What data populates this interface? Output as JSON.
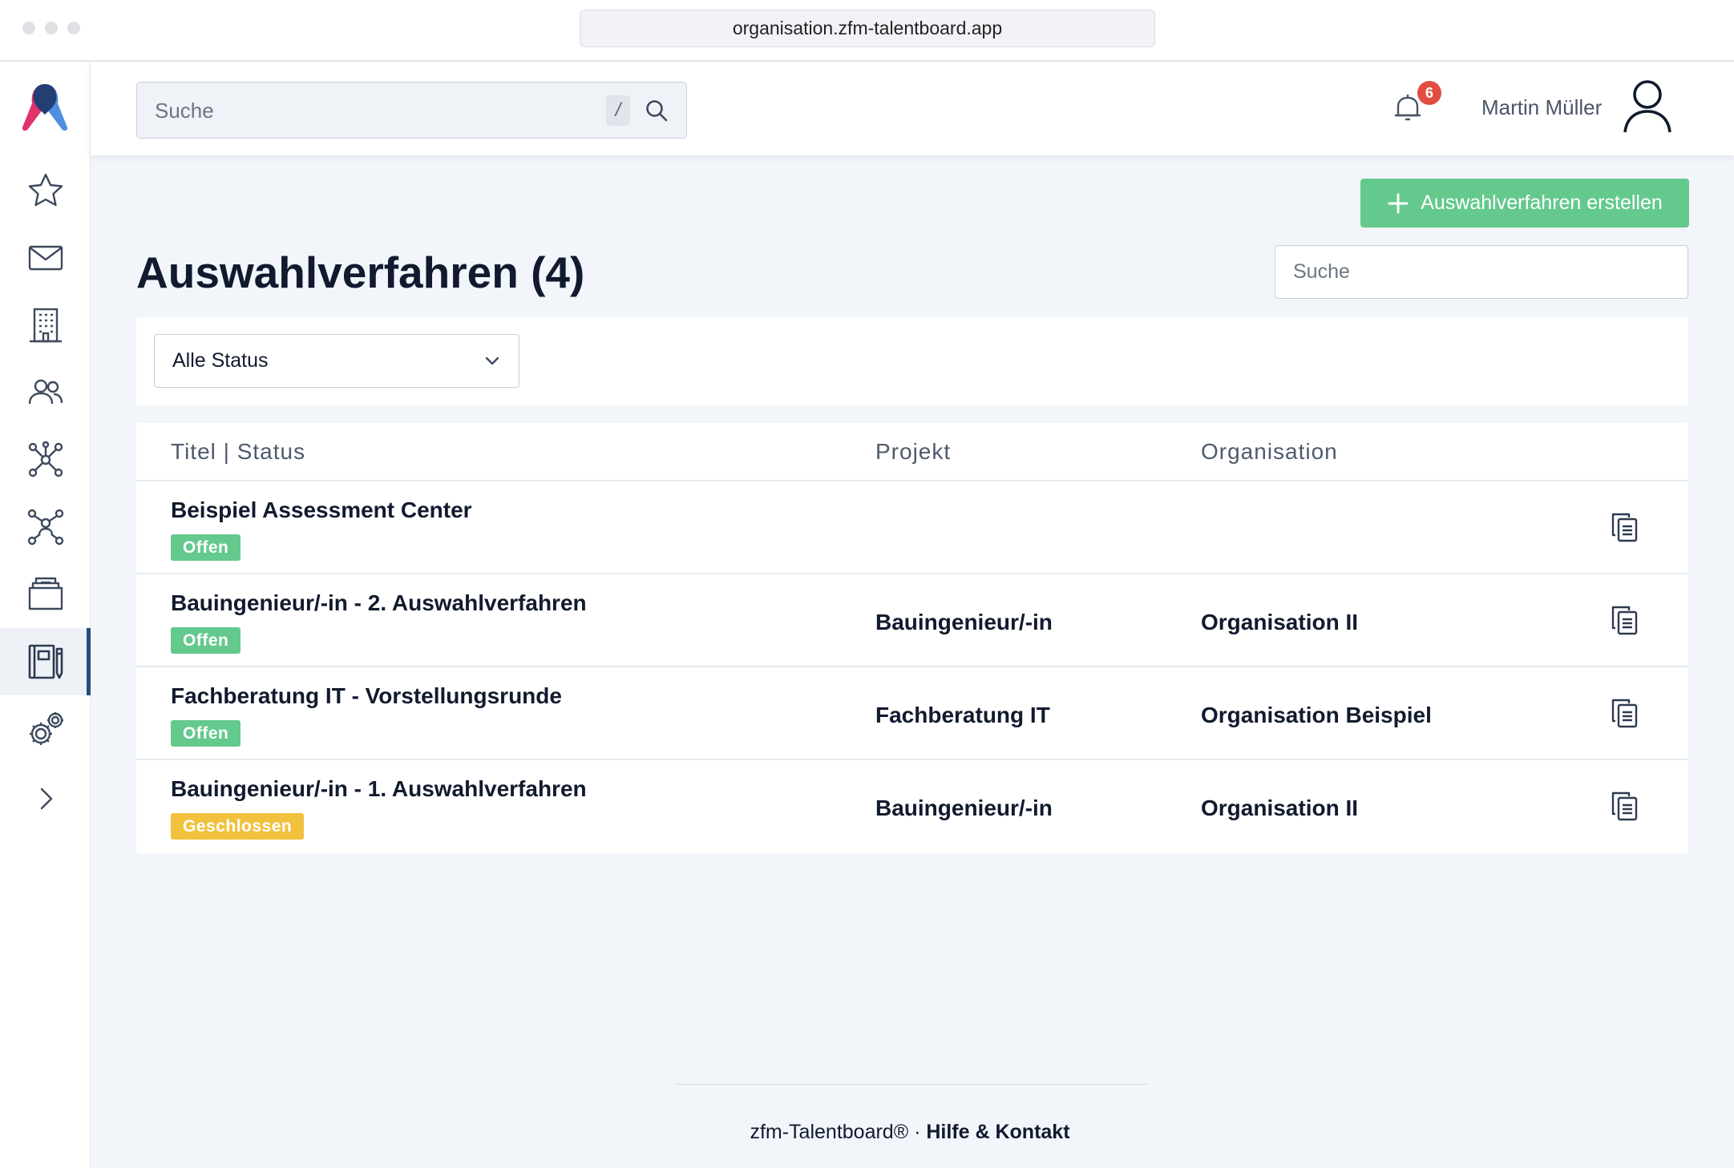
{
  "browser": {
    "url": "organisation.zfm-talentboard.app"
  },
  "header": {
    "search_placeholder": "Suche",
    "search_shortcut": "/",
    "notification_count": "6",
    "user_name": "Martin Müller"
  },
  "sidebar": {
    "items": [
      {
        "icon": "star-icon",
        "active": false
      },
      {
        "icon": "mail-icon",
        "active": false
      },
      {
        "icon": "building-icon",
        "active": false
      },
      {
        "icon": "users-icon",
        "active": false
      },
      {
        "icon": "network-icon",
        "active": false
      },
      {
        "icon": "network-people-icon",
        "active": false
      },
      {
        "icon": "folder-icon",
        "active": false
      },
      {
        "icon": "notebook-pen-icon",
        "active": true
      },
      {
        "icon": "gears-icon",
        "active": false
      },
      {
        "icon": "chevron-right-icon",
        "active": false
      }
    ]
  },
  "main": {
    "create_button_label": "Auswahlverfahren erstellen",
    "title": "Auswahlverfahren (4)",
    "search_placeholder": "Suche",
    "status_filter": {
      "selected": "Alle Status"
    },
    "table": {
      "columns": [
        "Titel | Status",
        "Projekt",
        "Organisation"
      ],
      "rows": [
        {
          "title": "Beispiel Assessment Center",
          "status": "Offen",
          "project": "",
          "organisation": ""
        },
        {
          "title": "Bauingenieur/-in - 2. Auswahlverfahren",
          "status": "Offen",
          "project": "Bauingenieur/-in",
          "organisation": "Organisation II"
        },
        {
          "title": "Fachberatung IT - Vorstellungsrunde",
          "status": "Offen",
          "project": "Fachberatung IT",
          "organisation": "Organisation Beispiel"
        },
        {
          "title": "Bauingenieur/-in - 1. Auswahlverfahren",
          "status": "Geschlossen",
          "project": "Bauingenieur/-in",
          "organisation": "Organisation II"
        }
      ]
    }
  },
  "footer": {
    "brand": "zfm-Talentboard®",
    "separator": "·",
    "help_link": "Hilfe & Kontakt"
  },
  "colors": {
    "accent_green": "#64c98d",
    "closed_yellow": "#f2c13e",
    "badge_red": "#e14d41",
    "nav_active": "#2a4a7e"
  }
}
